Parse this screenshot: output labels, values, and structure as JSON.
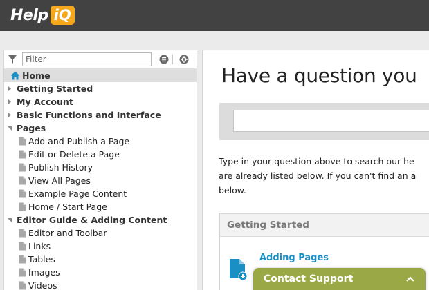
{
  "header": {
    "logo_help": "Help",
    "logo_iq": "iQ"
  },
  "sidebar": {
    "filter_placeholder": "Filter",
    "tree": [
      {
        "label": "Home",
        "level": 0,
        "kind": "home",
        "selected": true
      },
      {
        "label": "Getting Started",
        "level": 0,
        "kind": "folder",
        "expanded": false
      },
      {
        "label": "My Account",
        "level": 0,
        "kind": "folder",
        "expanded": false
      },
      {
        "label": "Basic Functions and Interface",
        "level": 0,
        "kind": "folder",
        "expanded": false
      },
      {
        "label": "Pages",
        "level": 0,
        "kind": "folder",
        "expanded": true
      },
      {
        "label": "Add and Publish a Page",
        "level": 1,
        "kind": "page"
      },
      {
        "label": "Edit or Delete a Page",
        "level": 1,
        "kind": "page"
      },
      {
        "label": "Publish History",
        "level": 1,
        "kind": "page"
      },
      {
        "label": "View All Pages",
        "level": 1,
        "kind": "page"
      },
      {
        "label": "Example Page Content",
        "level": 1,
        "kind": "page"
      },
      {
        "label": "Home / Start Page",
        "level": 1,
        "kind": "page"
      },
      {
        "label": "Editor Guide & Adding Content",
        "level": 0,
        "kind": "folder",
        "expanded": true
      },
      {
        "label": "Editor and Toolbar",
        "level": 1,
        "kind": "page"
      },
      {
        "label": "Links",
        "level": 1,
        "kind": "page"
      },
      {
        "label": "Tables",
        "level": 1,
        "kind": "page"
      },
      {
        "label": "Images",
        "level": 1,
        "kind": "page"
      },
      {
        "label": "Videos",
        "level": 1,
        "kind": "page"
      }
    ]
  },
  "main": {
    "headline": "Have a question you",
    "search_value": "",
    "intro_lines": [
      "Type in your question above to search our he",
      "are already listed below. If you can't find an a",
      "below."
    ],
    "card": {
      "title": "Getting Started",
      "item_label": "Adding Pages"
    }
  },
  "contact": {
    "label": "Contact Support"
  },
  "colors": {
    "topbar": "#424242",
    "logo_badge": "#f5a81c",
    "link": "#1a8fc4",
    "contact": "#9aa845",
    "home_icon": "#1a8fc4"
  },
  "icons": {
    "filter": "funnel-icon",
    "list_view": "list-icon",
    "settings": "settings-icon",
    "home": "house-icon",
    "page": "document-icon",
    "add_page": "add-document-icon",
    "chevron": "chevron-up-icon"
  }
}
